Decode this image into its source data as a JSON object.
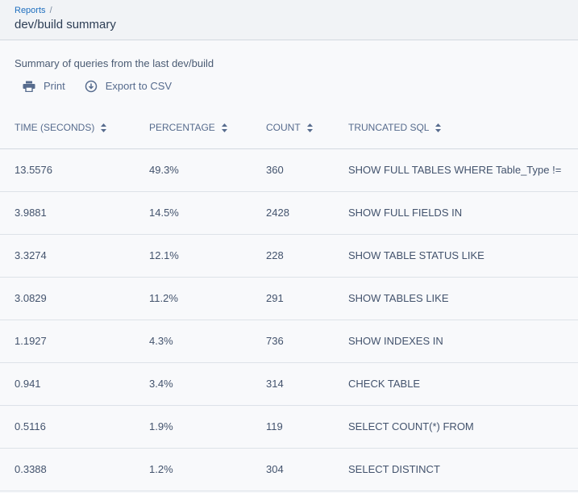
{
  "breadcrumb": {
    "parent": "Reports",
    "separator": "/"
  },
  "page": {
    "title": "dev/build summary",
    "description": "Summary of queries from the last dev/build"
  },
  "actions": {
    "print": "Print",
    "export": "Export to CSV"
  },
  "table": {
    "headers": [
      "TIME (SECONDS)",
      "PERCENTAGE",
      "COUNT",
      "TRUNCATED SQL"
    ],
    "rows": [
      [
        "13.5576",
        "49.3%",
        "360",
        "SHOW FULL TABLES WHERE Table_Type !="
      ],
      [
        "3.9881",
        "14.5%",
        "2428",
        "SHOW FULL FIELDS IN"
      ],
      [
        "3.3274",
        "12.1%",
        "228",
        "SHOW TABLE STATUS LIKE"
      ],
      [
        "3.0829",
        "11.2%",
        "291",
        "SHOW TABLES LIKE"
      ],
      [
        "1.1927",
        "4.3%",
        "736",
        "SHOW INDEXES IN"
      ],
      [
        "0.941",
        "3.4%",
        "314",
        "CHECK TABLE"
      ],
      [
        "0.5116",
        "1.9%",
        "119",
        "SELECT COUNT(*) FROM"
      ],
      [
        "0.3388",
        "1.2%",
        "304",
        "SELECT DISTINCT"
      ]
    ]
  },
  "icons": {
    "print": "printer-icon",
    "export": "download-circle-icon",
    "sort": "sort-icon"
  },
  "colors": {
    "link": "#1f6fbf",
    "text": "#43536d",
    "border": "#d3d9e0"
  }
}
